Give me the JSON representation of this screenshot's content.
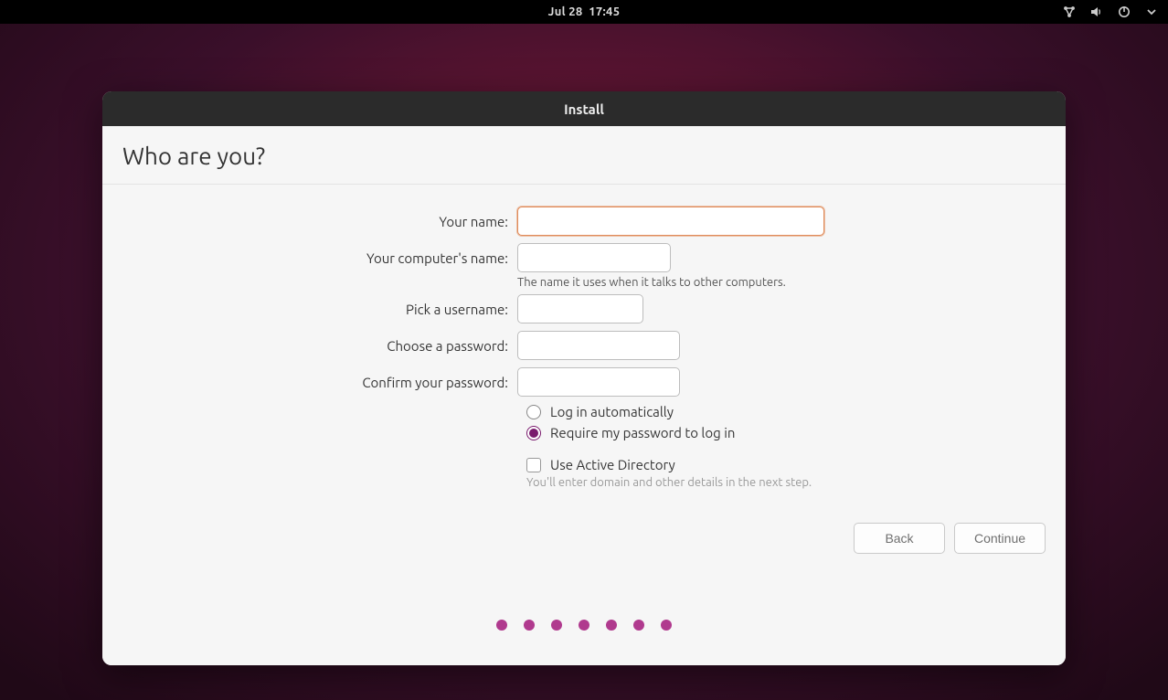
{
  "topbar": {
    "date": "Jul 28",
    "time": "17:45"
  },
  "window": {
    "title": "Install",
    "heading": "Who are you?"
  },
  "form": {
    "name_label": "Your name:",
    "name_value": "",
    "host_label": "Your computer's name:",
    "host_value": "",
    "host_hint": "The name it uses when it talks to other computers.",
    "user_label": "Pick a username:",
    "user_value": "",
    "pass_label": "Choose a password:",
    "pass_value": "",
    "confirm_label": "Confirm your password:",
    "confirm_value": "",
    "login_auto_label": "Log in automatically",
    "login_require_label": "Require my password to log in",
    "login_selected": "require",
    "ad_label": "Use Active Directory",
    "ad_checked": false,
    "ad_hint": "You'll enter domain and other details in the next step."
  },
  "buttons": {
    "back": "Back",
    "continue": "Continue"
  },
  "progress": {
    "total_steps": 7,
    "current_step": 7
  },
  "colors": {
    "accent": "#7a1b6d",
    "focus_ring": "#e08b5a",
    "progress_dot": "#b03a8e"
  }
}
